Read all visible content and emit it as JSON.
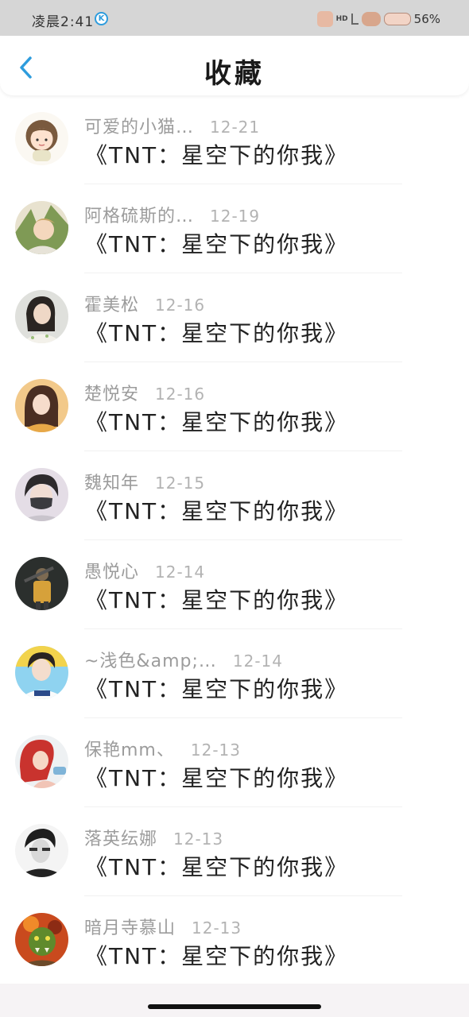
{
  "status_bar": {
    "time": "凌晨2:41",
    "k_badge": "K",
    "hd": "HD",
    "battery": "56%"
  },
  "header": {
    "title": "收藏",
    "back_icon": "chevron-left-icon",
    "accent": "#2e9cdd"
  },
  "items": [
    {
      "name": "可爱的小猫…",
      "date": "12-21",
      "title": "《TNT：星空下的你我》",
      "avatar": "cartoon-girl-avatar"
    },
    {
      "name": "阿格硫斯的…",
      "date": "12-19",
      "title": "《TNT：星空下的你我》",
      "avatar": "anime-boy-avatar"
    },
    {
      "name": "霍美松",
      "date": "12-16",
      "title": "《TNT：星空下的你我》",
      "avatar": "girl-photo-avatar"
    },
    {
      "name": "楚悦安",
      "date": "12-16",
      "title": "《TNT：星空下的你我》",
      "avatar": "girl-photo-avatar"
    },
    {
      "name": "魏知年",
      "date": "12-15",
      "title": "《TNT：星空下的你我》",
      "avatar": "masked-boy-avatar"
    },
    {
      "name": "愚悦心",
      "date": "12-14",
      "title": "《TNT：星空下的你我》",
      "avatar": "game-character-avatar"
    },
    {
      "name": "~浅色&amp;…",
      "date": "12-14",
      "title": "《TNT：星空下的你我》",
      "avatar": "boy-photo-avatar"
    },
    {
      "name": "保艳mm、",
      "date": "12-13",
      "title": "《TNT：星空下的你我》",
      "avatar": "red-hair-girl-avatar"
    },
    {
      "name": "落英纭娜",
      "date": "12-13",
      "title": "《TNT：星空下的你我》",
      "avatar": "bw-portrait-avatar"
    },
    {
      "name": "暗月寺慕山",
      "date": "12-13",
      "title": "《TNT：星空下的你我》",
      "avatar": "orc-warrior-avatar"
    }
  ]
}
